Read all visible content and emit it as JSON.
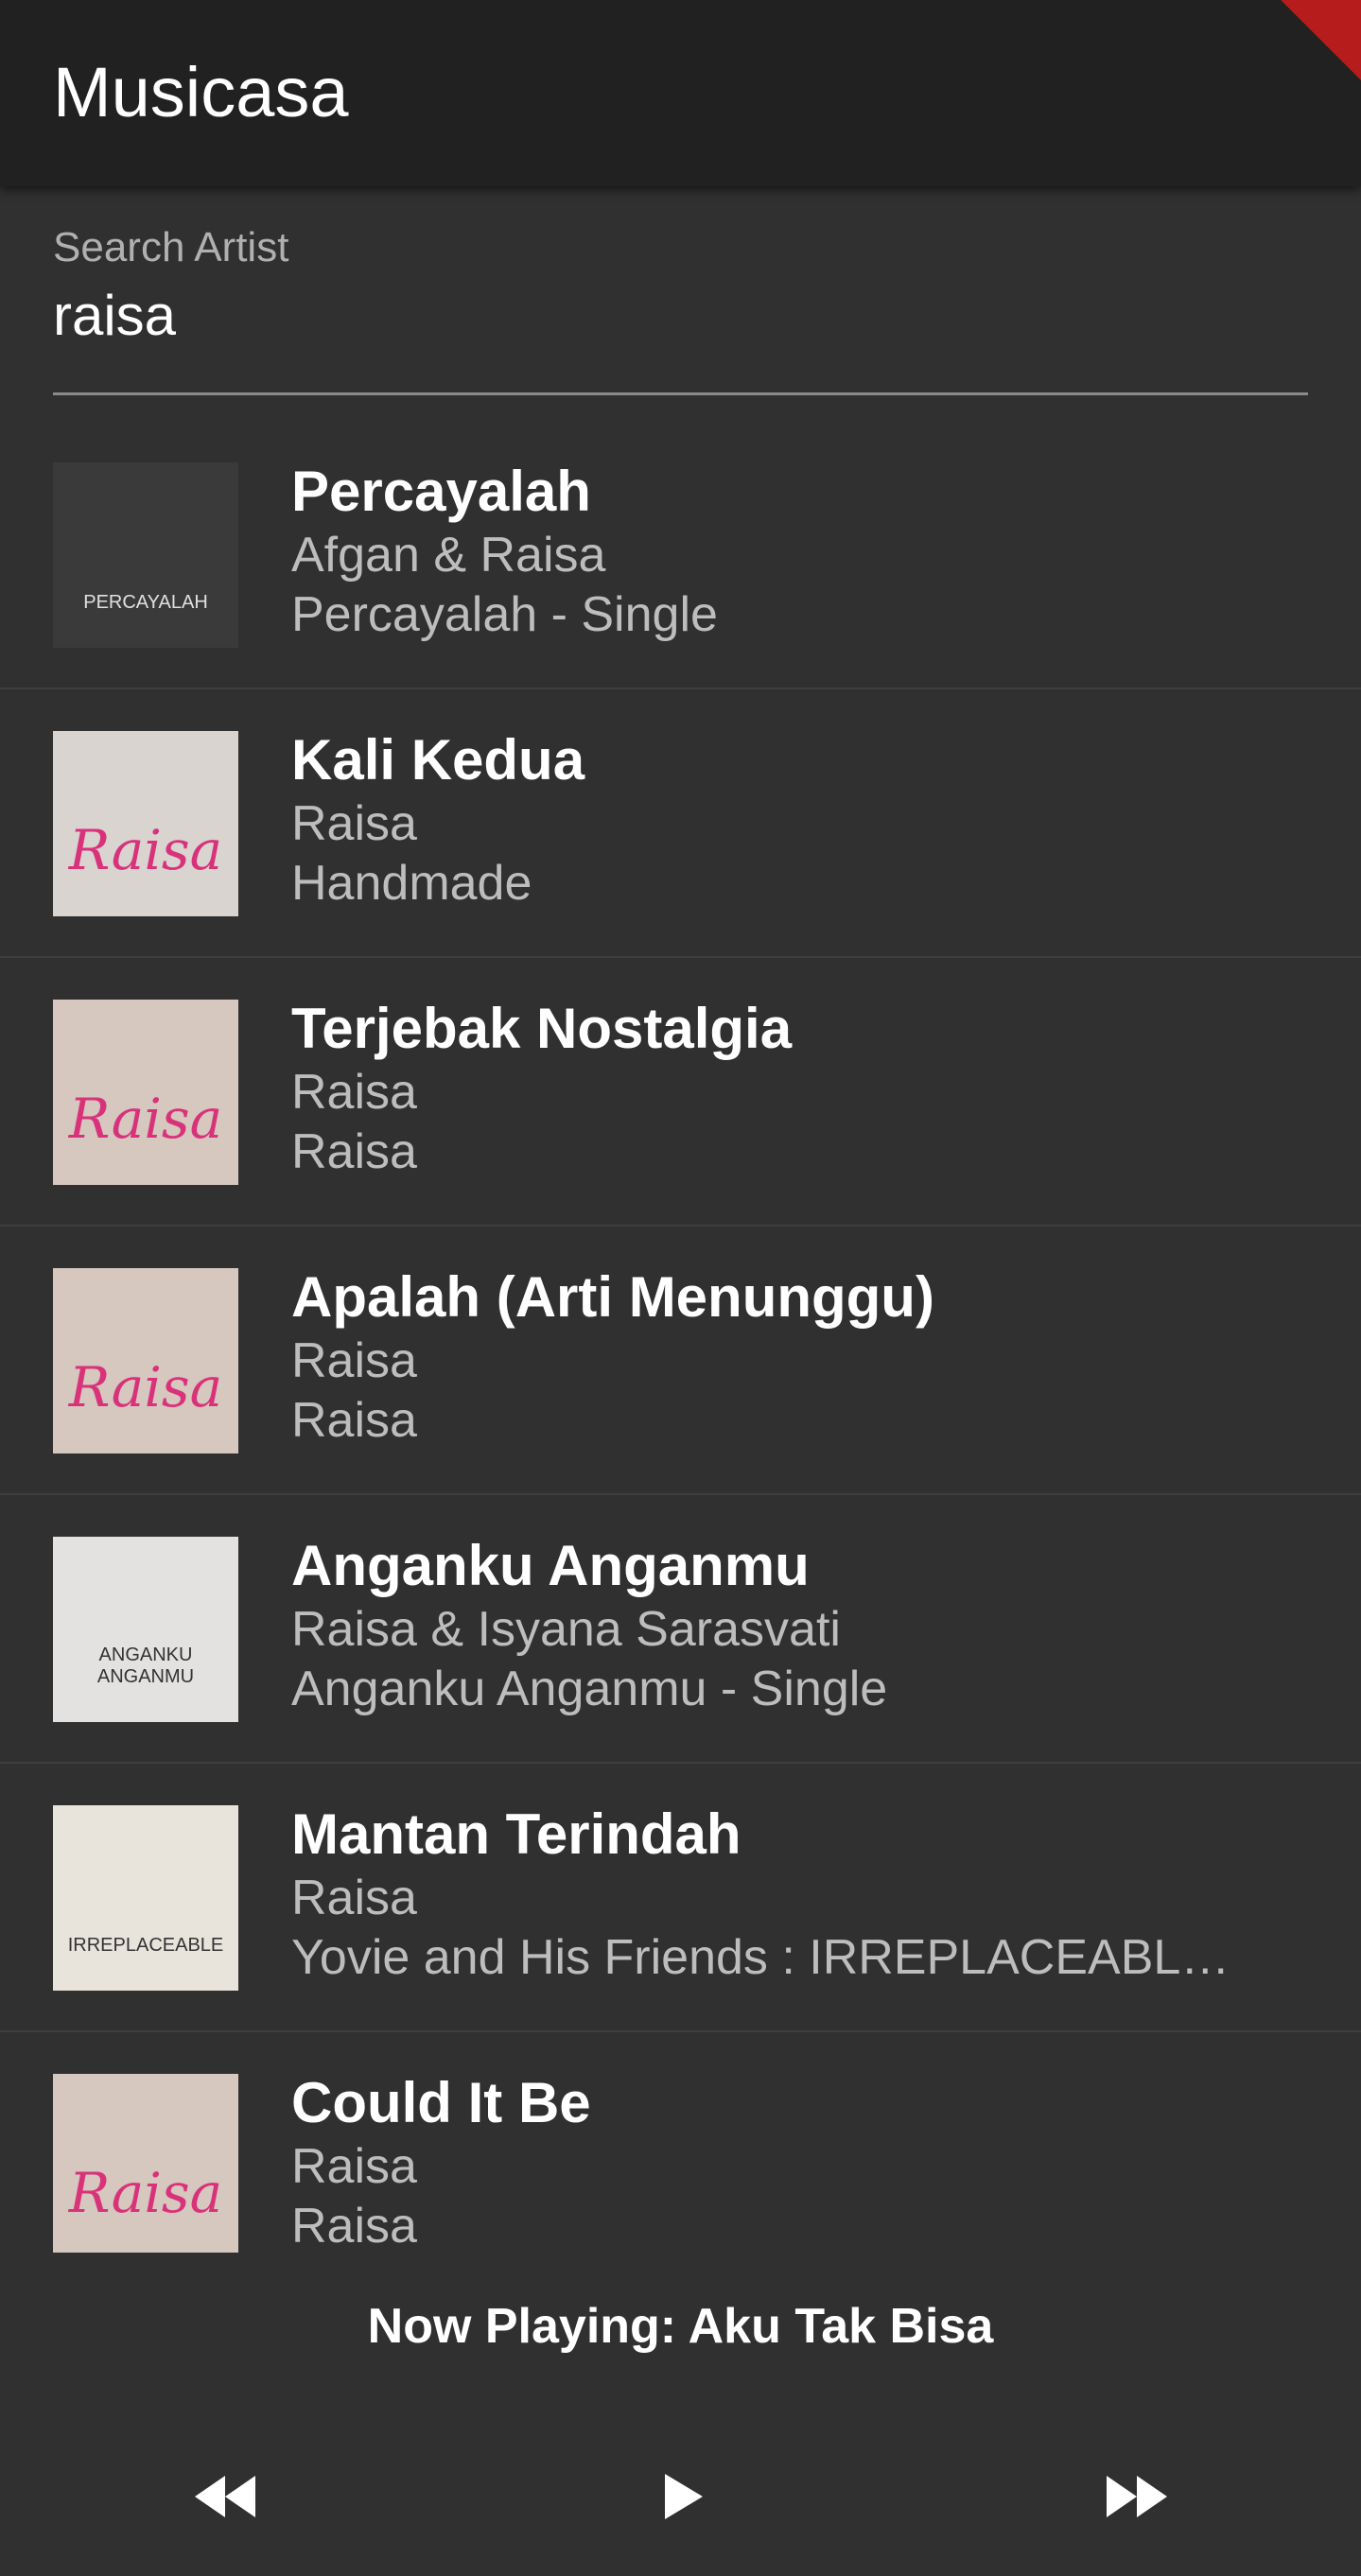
{
  "app": {
    "title": "Musicasa"
  },
  "search": {
    "label": "Search Artist",
    "value": "raisa"
  },
  "songs": [
    {
      "title": "Percayalah",
      "artist": "Afgan & Raisa",
      "album": "Percayalah - Single",
      "cover_text": "PERCAYALAH",
      "cover_color": "#3a3a3a"
    },
    {
      "title": "Kali Kedua",
      "artist": "Raisa",
      "album": "Handmade",
      "cover_text": "Raisa",
      "cover_color": "#d9d4d0"
    },
    {
      "title": "Terjebak Nostalgia",
      "artist": "Raisa",
      "album": "Raisa",
      "cover_text": "Raisa",
      "cover_color": "#d6c7bf"
    },
    {
      "title": "Apalah (Arti Menunggu)",
      "artist": "Raisa",
      "album": "Raisa",
      "cover_text": "Raisa",
      "cover_color": "#d6c7bf"
    },
    {
      "title": "Anganku Anganmu",
      "artist": "Raisa & Isyana Sarasvati",
      "album": "Anganku Anganmu - Single",
      "cover_text": "ANGANKU ANGANMU",
      "cover_color": "#e4e2e0"
    },
    {
      "title": "Mantan Terindah",
      "artist": "Raisa",
      "album": "Yovie and His Friends : IRREPLACEABLE ...",
      "cover_text": "IRREPLACEABLE",
      "cover_color": "#e8e4dc"
    },
    {
      "title": "Could It Be",
      "artist": "Raisa",
      "album": "Raisa",
      "cover_text": "Raisa",
      "cover_color": "#d6c7bf"
    }
  ],
  "player": {
    "now_playing": "Now Playing: Aku Tak Bisa",
    "prev_icon": "fast-rewind-icon",
    "play_icon": "play-arrow-icon",
    "next_icon": "fast-forward-icon"
  },
  "colors": {
    "background": "#303030",
    "appbar": "#212121",
    "primary_text": "#ffffff",
    "secondary_text": "#bdbdbd",
    "cover_accent": "#d8337a"
  }
}
